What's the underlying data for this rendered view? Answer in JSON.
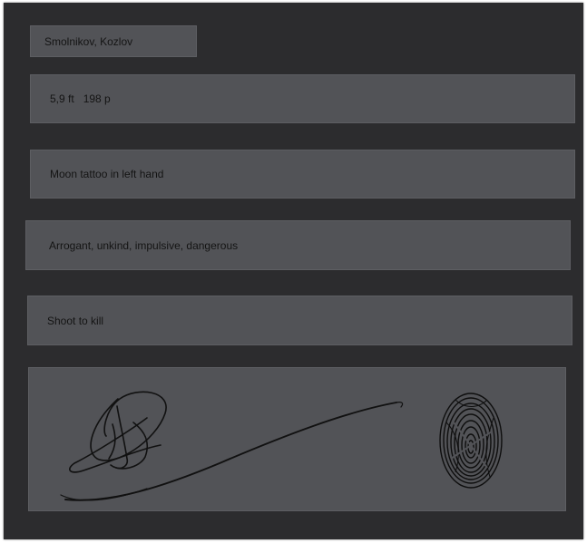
{
  "dossier": {
    "names": "Smolnikov, Kozlov",
    "height": "5,9 ft",
    "weight": "198 p",
    "marks": "Moon tattoo in left hand",
    "traits": "Arrogant, unkind, impulsive, dangerous",
    "orders": "Shoot to kill"
  },
  "colors": {
    "background": "#2c2c2e",
    "field": "#525357",
    "text": "#141414",
    "ink": "#111111"
  },
  "icons": {
    "signature": "signature-scribble",
    "fingerprint": "fingerprint-icon"
  }
}
